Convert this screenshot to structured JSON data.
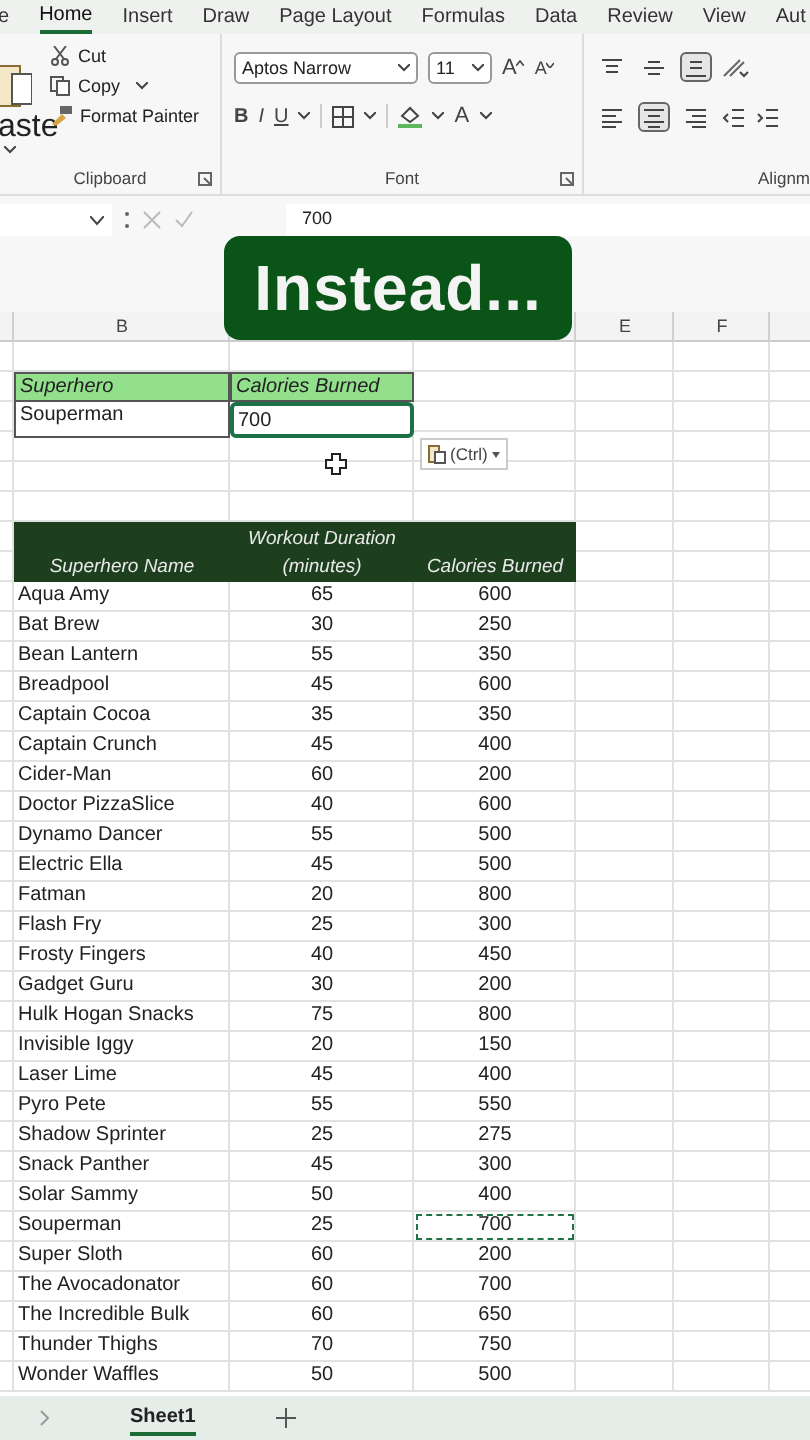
{
  "ribbon_tabs": [
    {
      "label": "e",
      "selected": false
    },
    {
      "label": "Home",
      "selected": true
    },
    {
      "label": "Insert",
      "selected": false
    },
    {
      "label": "Draw",
      "selected": false
    },
    {
      "label": "Page Layout",
      "selected": false
    },
    {
      "label": "Formulas",
      "selected": false
    },
    {
      "label": "Data",
      "selected": false
    },
    {
      "label": "Review",
      "selected": false
    },
    {
      "label": "View",
      "selected": false
    },
    {
      "label": "Aut",
      "selected": false
    }
  ],
  "clipboard": {
    "paste": "aste",
    "cut": "Cut",
    "copy": "Copy",
    "format_painter": "Format Painter",
    "label": "Clipboard"
  },
  "font": {
    "name": "Aptos Narrow",
    "size": "11",
    "grow": "A",
    "shrink": "A",
    "bold": "B",
    "italic": "I",
    "underline": "U",
    "ink_button": "A",
    "label": "Font"
  },
  "alignment": {
    "vertical_buttons": [
      {
        "kind": "top",
        "selected": false
      },
      {
        "kind": "middle",
        "selected": false
      },
      {
        "kind": "bottom",
        "selected": true
      }
    ],
    "horizontal_buttons": [
      {
        "kind": "left",
        "selected": false
      },
      {
        "kind": "center",
        "selected": true
      },
      {
        "kind": "right",
        "selected": false
      }
    ],
    "label": "Alignm"
  },
  "formula_bar": {
    "value": "700"
  },
  "overlay_caption": "Instead...",
  "column_headers": [
    "B",
    "E",
    "F"
  ],
  "summary_table": {
    "headers": [
      "Superhero",
      "Calories Burned"
    ],
    "row": {
      "name": "Souperman",
      "calories": "700",
      "selected": true
    }
  },
  "paste_options": {
    "label": "(Ctrl)"
  },
  "data_table": {
    "headers": [
      "Superhero Name",
      "Workout Duration (minutes)",
      "Calories Burned"
    ],
    "rows": [
      {
        "name": "Aqua Amy",
        "minutes": "65",
        "calories": "600",
        "copied": false
      },
      {
        "name": "Bat Brew",
        "minutes": "30",
        "calories": "250",
        "copied": false
      },
      {
        "name": "Bean Lantern",
        "minutes": "55",
        "calories": "350",
        "copied": false
      },
      {
        "name": "Breadpool",
        "minutes": "45",
        "calories": "600",
        "copied": false
      },
      {
        "name": "Captain Cocoa",
        "minutes": "35",
        "calories": "350",
        "copied": false
      },
      {
        "name": "Captain Crunch",
        "minutes": "45",
        "calories": "400",
        "copied": false
      },
      {
        "name": "Cider-Man",
        "minutes": "60",
        "calories": "200",
        "copied": false
      },
      {
        "name": "Doctor PizzaSlice",
        "minutes": "40",
        "calories": "600",
        "copied": false
      },
      {
        "name": "Dynamo Dancer",
        "minutes": "55",
        "calories": "500",
        "copied": false
      },
      {
        "name": "Electric Ella",
        "minutes": "45",
        "calories": "500",
        "copied": false
      },
      {
        "name": "Fatman",
        "minutes": "20",
        "calories": "800",
        "copied": false
      },
      {
        "name": "Flash Fry",
        "minutes": "25",
        "calories": "300",
        "copied": false
      },
      {
        "name": "Frosty Fingers",
        "minutes": "40",
        "calories": "450",
        "copied": false
      },
      {
        "name": "Gadget Guru",
        "minutes": "30",
        "calories": "200",
        "copied": false
      },
      {
        "name": "Hulk Hogan Snacks",
        "minutes": "75",
        "calories": "800",
        "copied": false
      },
      {
        "name": "Invisible Iggy",
        "minutes": "20",
        "calories": "150",
        "copied": false
      },
      {
        "name": "Laser Lime",
        "minutes": "45",
        "calories": "400",
        "copied": false
      },
      {
        "name": "Pyro Pete",
        "minutes": "55",
        "calories": "550",
        "copied": false
      },
      {
        "name": "Shadow Sprinter",
        "minutes": "25",
        "calories": "275",
        "copied": false
      },
      {
        "name": "Snack Panther",
        "minutes": "45",
        "calories": "300",
        "copied": false
      },
      {
        "name": "Solar Sammy",
        "minutes": "50",
        "calories": "400",
        "copied": false
      },
      {
        "name": "Souperman",
        "minutes": "25",
        "calories": "700",
        "copied": true
      },
      {
        "name": "Super Sloth",
        "minutes": "60",
        "calories": "200",
        "copied": false
      },
      {
        "name": "The Avocadonator",
        "minutes": "60",
        "calories": "700",
        "copied": false
      },
      {
        "name": "The Incredible Bulk",
        "minutes": "60",
        "calories": "650",
        "copied": false
      },
      {
        "name": "Thunder Thighs",
        "minutes": "70",
        "calories": "750",
        "copied": false
      },
      {
        "name": "Wonder Waffles",
        "minutes": "50",
        "calories": "500",
        "copied": false
      }
    ]
  },
  "sheet_tabs": [
    {
      "label": "Sheet1",
      "selected": true
    }
  ]
}
